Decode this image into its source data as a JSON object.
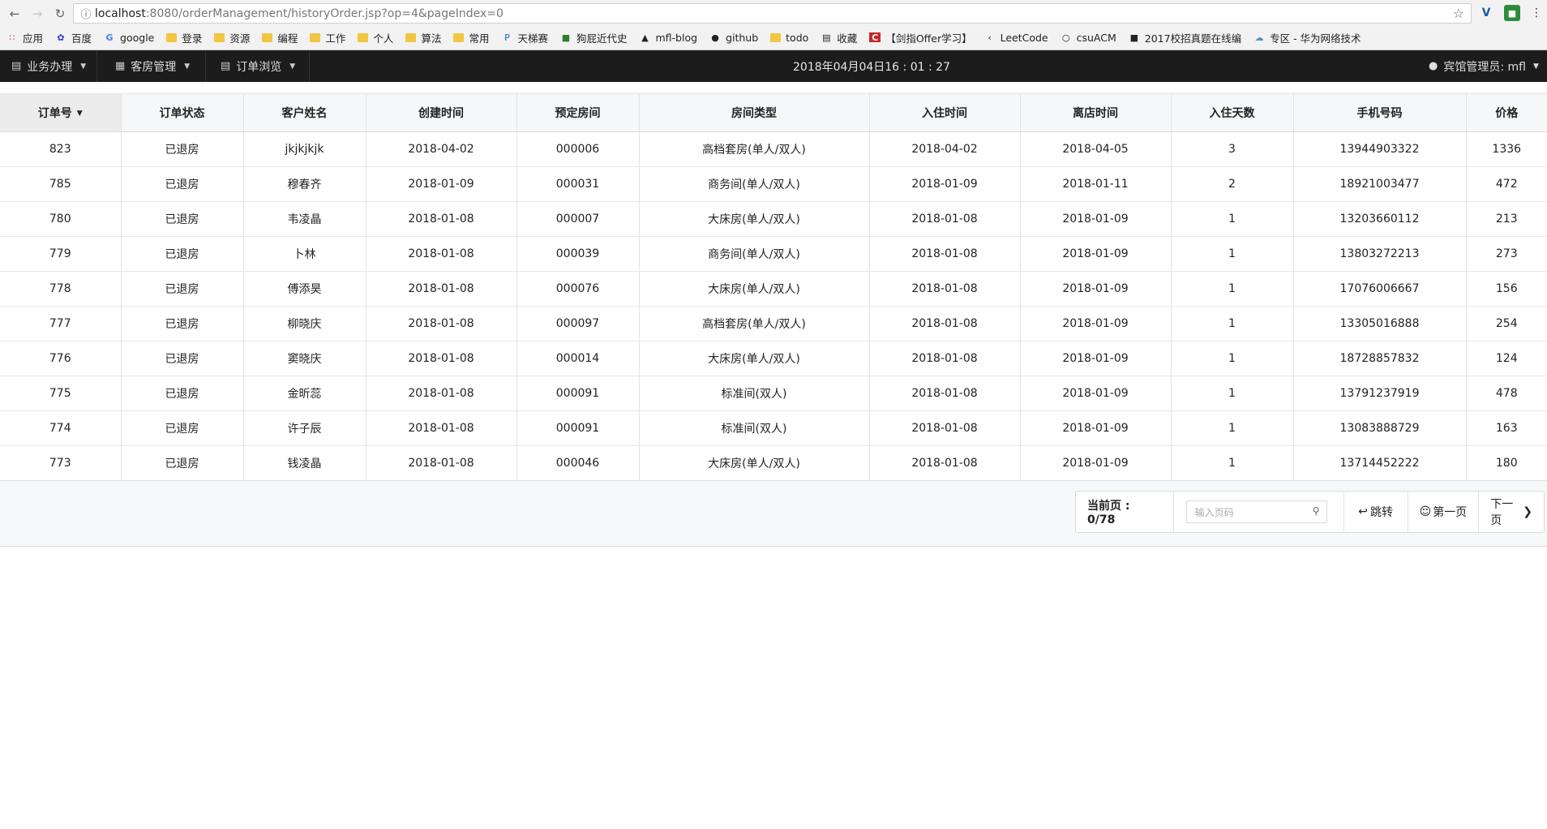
{
  "browser": {
    "url_host": "localhost",
    "url_rest": ":8080/orderManagement/historyOrder.jsp?op=4&pageIndex=0",
    "bookmarks": [
      {
        "icon": "apps-icon",
        "label": "应用"
      },
      {
        "icon": "baidu-icon",
        "label": "百度"
      },
      {
        "icon": "google-icon",
        "label": "google"
      },
      {
        "icon": "folder-icon",
        "label": "登录"
      },
      {
        "icon": "folder-icon",
        "label": "资源"
      },
      {
        "icon": "folder-icon",
        "label": "编程"
      },
      {
        "icon": "folder-icon",
        "label": "工作"
      },
      {
        "icon": "folder-icon",
        "label": "个人"
      },
      {
        "icon": "folder-icon",
        "label": "算法"
      },
      {
        "icon": "folder-icon",
        "label": "常用"
      },
      {
        "icon": "pat-icon",
        "label": "天梯赛"
      },
      {
        "icon": "map-icon",
        "label": "狗屁近代史"
      },
      {
        "icon": "blog-icon",
        "label": "mfl-blog"
      },
      {
        "icon": "github-icon",
        "label": "github"
      },
      {
        "icon": "folder-icon",
        "label": "todo"
      },
      {
        "icon": "book-icon",
        "label": "收藏"
      },
      {
        "icon": "c-icon",
        "label": "【剑指Offer学习】"
      },
      {
        "icon": "leetcode-icon",
        "label": "LeetCode"
      },
      {
        "icon": "acm-icon",
        "label": "csuACM"
      },
      {
        "icon": "nk-icon",
        "label": "2017校招真题在线编"
      },
      {
        "icon": "cloud-icon",
        "label": "专区 - 华为网络技术"
      }
    ]
  },
  "navbar": {
    "menu1": "业务办理",
    "menu2": "客房管理",
    "menu3": "订单浏览",
    "datetime": "2018年04月04日16 : 01 : 27",
    "user": "宾馆管理员: mfl"
  },
  "table": {
    "headers": [
      "订单号",
      "订单状态",
      "客户姓名",
      "创建时间",
      "预定房间",
      "房间类型",
      "入住时间",
      "离店时间",
      "入住天数",
      "手机号码",
      "价格"
    ],
    "rows": [
      [
        "823",
        "已退房",
        "jkjkjkjk",
        "2018-04-02",
        "000006",
        "高档套房(单人/双人)",
        "2018-04-02",
        "2018-04-05",
        "3",
        "13944903322",
        "1336"
      ],
      [
        "785",
        "已退房",
        "穆春齐",
        "2018-01-09",
        "000031",
        "商务间(单人/双人)",
        "2018-01-09",
        "2018-01-11",
        "2",
        "18921003477",
        "472"
      ],
      [
        "780",
        "已退房",
        "韦凌晶",
        "2018-01-08",
        "000007",
        "大床房(单人/双人)",
        "2018-01-08",
        "2018-01-09",
        "1",
        "13203660112",
        "213"
      ],
      [
        "779",
        "已退房",
        "卜林",
        "2018-01-08",
        "000039",
        "商务间(单人/双人)",
        "2018-01-08",
        "2018-01-09",
        "1",
        "13803272213",
        "273"
      ],
      [
        "778",
        "已退房",
        "傅添昊",
        "2018-01-08",
        "000076",
        "大床房(单人/双人)",
        "2018-01-08",
        "2018-01-09",
        "1",
        "17076006667",
        "156"
      ],
      [
        "777",
        "已退房",
        "柳晓庆",
        "2018-01-08",
        "000097",
        "高档套房(单人/双人)",
        "2018-01-08",
        "2018-01-09",
        "1",
        "13305016888",
        "254"
      ],
      [
        "776",
        "已退房",
        "窦晓庆",
        "2018-01-08",
        "000014",
        "大床房(单人/双人)",
        "2018-01-08",
        "2018-01-09",
        "1",
        "18728857832",
        "124"
      ],
      [
        "775",
        "已退房",
        "金昕蕊",
        "2018-01-08",
        "000091",
        "标准间(双人)",
        "2018-01-08",
        "2018-01-09",
        "1",
        "13791237919",
        "478"
      ],
      [
        "774",
        "已退房",
        "许子辰",
        "2018-01-08",
        "000091",
        "标准间(双人)",
        "2018-01-08",
        "2018-01-09",
        "1",
        "13083888729",
        "163"
      ],
      [
        "773",
        "已退房",
        "钱凌晶",
        "2018-01-08",
        "000046",
        "大床房(单人/双人)",
        "2018-01-08",
        "2018-01-09",
        "1",
        "13714452222",
        "180"
      ]
    ]
  },
  "pager": {
    "current": "当前页 : 0/78",
    "placeholder": "输入页码",
    "jump": "跳转",
    "first": "第一页",
    "next": "下一页"
  }
}
